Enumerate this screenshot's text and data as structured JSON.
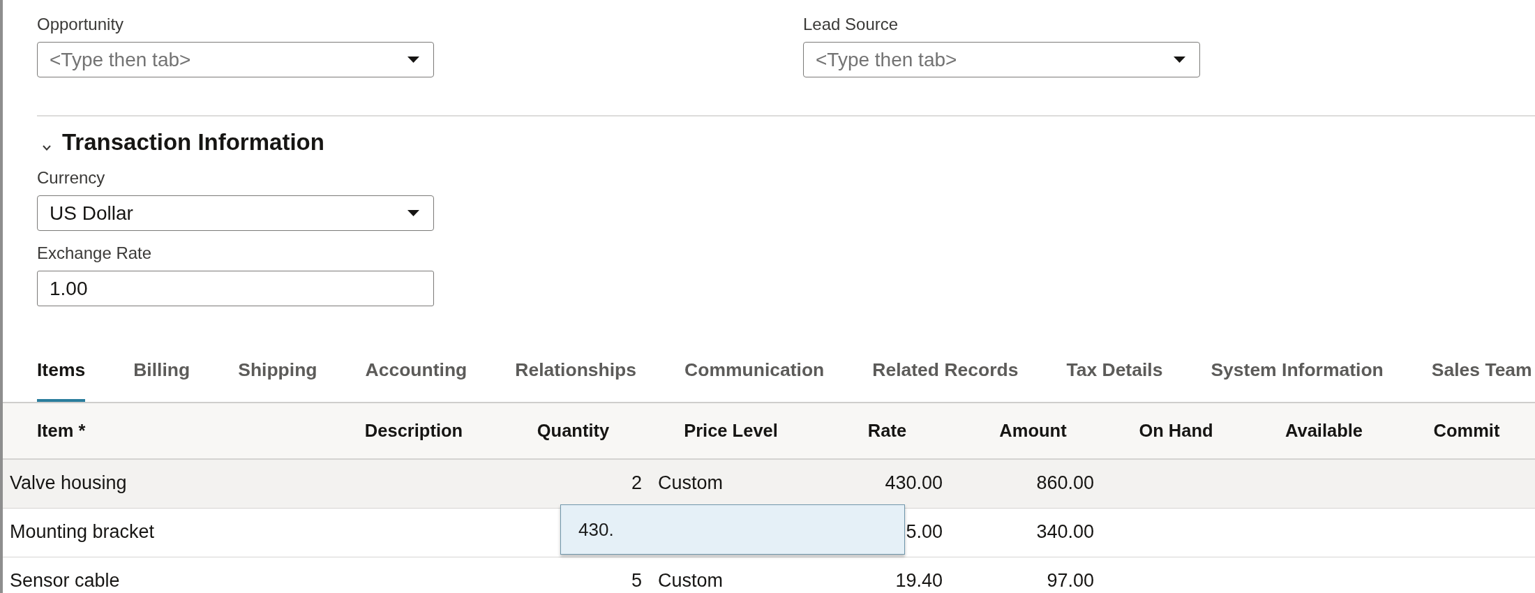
{
  "form_fields": [
    {
      "label": "Opportunity",
      "kind": "select",
      "placeholder": "<Type then tab>"
    },
    {
      "label": "Lead Source",
      "kind": "select",
      "placeholder": "<Type then tab>"
    }
  ],
  "section": {
    "title": "Transaction Information",
    "expanded": true,
    "fields": [
      {
        "label": "Currency",
        "kind": "select",
        "value": "US Dollar"
      },
      {
        "label": "Exchange Rate",
        "kind": "text",
        "value": "1.00"
      }
    ]
  },
  "tabs": [
    {
      "label": "Items",
      "selected": true
    },
    {
      "label": "Billing",
      "selected": false
    },
    {
      "label": "Shipping",
      "selected": false
    },
    {
      "label": "Accounting",
      "selected": false
    },
    {
      "label": "Relationships",
      "selected": false
    },
    {
      "label": "Communication",
      "selected": false
    },
    {
      "label": "Related Records",
      "selected": false
    },
    {
      "label": "Tax Details",
      "selected": false
    },
    {
      "label": "System Information",
      "selected": false
    },
    {
      "label": "Sales Team",
      "selected": false
    }
  ],
  "table": {
    "columns": [
      "Item *",
      "Description",
      "Quantity",
      "Price Level",
      "Rate",
      "Amount",
      "On Hand",
      "Available",
      "Commit"
    ],
    "rows": [
      {
        "selected": true,
        "item": "Valve housing",
        "quantity": "2",
        "price_level": "Custom",
        "rate": "430.00",
        "amount": "860.00"
      },
      {
        "selected": false,
        "item": "Mounting bracket",
        "rate": "5.00",
        "amount": "340.00"
      },
      {
        "selected": false,
        "item": "Sensor cable",
        "quantity": "5",
        "price_level": "Custom",
        "rate": "19.40",
        "amount": "97.00"
      }
    ],
    "cell_editor": {
      "value": "430."
    }
  }
}
